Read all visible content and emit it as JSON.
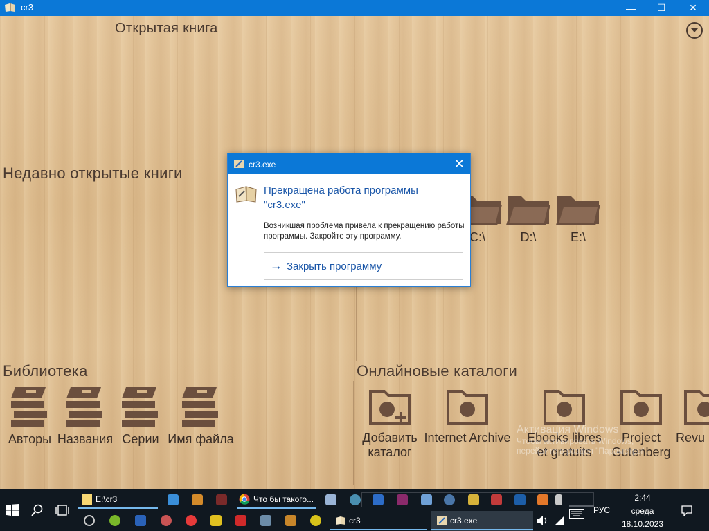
{
  "window": {
    "title": "cr3",
    "minimize_glyph": "—",
    "maximize_glyph": "☐",
    "close_glyph": "✕"
  },
  "app": {
    "open_book_heading": "Открытая книга",
    "recent_heading": "Недавно открытые книги",
    "library_heading": "Библиотека",
    "online_heading": "Онлайновые каталоги",
    "drives": [
      {
        "label": "C:\\"
      },
      {
        "label": "D:\\"
      },
      {
        "label": "E:\\"
      }
    ],
    "library_items": [
      {
        "label": "Авторы"
      },
      {
        "label": "Названия"
      },
      {
        "label": "Серии"
      },
      {
        "label": "Имя файла"
      }
    ],
    "catalogs": [
      {
        "line1": "Добавить",
        "line2": "каталог"
      },
      {
        "line1": "Internet Archive",
        "line2": ""
      },
      {
        "line1": "Ebooks libres",
        "line2": "et gratuits"
      },
      {
        "line1": "Project",
        "line2": "Gutenberg"
      },
      {
        "line1": "Revu",
        "line2": ""
      }
    ],
    "watermark_line1": "Активация Windows",
    "watermark_line2": "Чтобы активировать Windows,",
    "watermark_line3": "перейдите в раздел \"Параметры\"."
  },
  "dialog": {
    "title": "cr3.exe",
    "heading_line1": "Прекращена работа программы",
    "heading_line2": "\"cr3.exe\"",
    "body": "Возникшая проблема привела к прекращению работы программы. Закройте эту программу.",
    "action_label": "Закрыть программу",
    "close_glyph": "✕",
    "arrow_glyph": "→"
  },
  "taskbar": {
    "explorer_label": "E:\\cr3",
    "chrome_label": "Что бы такого...",
    "cr3_label": "cr3",
    "cr3exe_label": "cr3.exe",
    "language": "РУС",
    "time": "2:44",
    "day": "среда",
    "date": "18.10.2023"
  },
  "colors": {
    "titlebar": "#0b78d7",
    "wood": "#dcbb8d",
    "icon_brown": "#6b4f3e",
    "taskbar": "#101820",
    "link_blue": "#1a56a8"
  }
}
